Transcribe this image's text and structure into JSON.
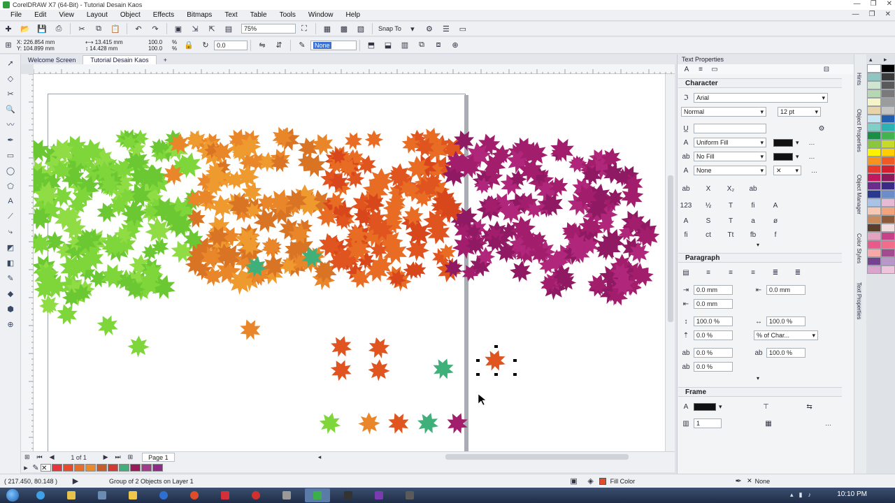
{
  "window": {
    "title": "CorelDRAW X7 (64-Bit) - Tutorial Desain Kaos"
  },
  "menu": [
    "File",
    "Edit",
    "View",
    "Layout",
    "Object",
    "Effects",
    "Bitmaps",
    "Text",
    "Table",
    "Tools",
    "Window",
    "Help"
  ],
  "toolbar1": {
    "zoom": "75%",
    "snap_to": "Snap To"
  },
  "toolbar2": {
    "x": "X: 226.854 mm",
    "y": "Y: 104.899 mm",
    "w": "13.415 mm",
    "h": "14.428 mm",
    "scale_w": "100.0",
    "scale_h": "100.0",
    "pct": "%",
    "rotation": "0.0",
    "outline": "None"
  },
  "tabs": [
    {
      "label": "Welcome Screen"
    },
    {
      "label": "Tutorial Desain Kaos"
    }
  ],
  "page_nav": {
    "pages": "1 of 1",
    "page_tab": "Page 1"
  },
  "status": {
    "coords": "( 217.450, 80.148 )",
    "message": "Group of 2 Objects on Layer 1",
    "fill_label": "Fill Color",
    "outline_label": "None"
  },
  "taskbar": {
    "time": "10:10 PM"
  },
  "docker": {
    "title": "Text Properties",
    "character": {
      "header": "Character",
      "font": "Arial",
      "style": "Normal",
      "size": "12 pt",
      "fill_type": "Uniform Fill",
      "bg_fill": "No Fill",
      "outline": "None"
    },
    "paragraph": {
      "header": "Paragraph",
      "left_indent": "0.0 mm",
      "right_indent": "0.0 mm",
      "first_indent": "0.0 mm",
      "line_spacing": "100.0 %",
      "char_spacing": "100.0 %",
      "before": "0.0 %",
      "spacing_unit": "% of Char...",
      "after": "0.0 %",
      "word_spacing": "100.0 %",
      "lang_spacing": "0.0 %"
    },
    "frame": {
      "header": "Frame",
      "columns": "1"
    }
  },
  "docker_side_tabs": [
    "Hints",
    "Object Properties",
    "Object Manager",
    "Color Styles",
    "Text Properties"
  ],
  "palette_colors": [
    "#ffffff",
    "#000000",
    "#8fc7c0",
    "#3a3a3a",
    "#cfe5cf",
    "#5a5a5a",
    "#b6d7b1",
    "#7a7a7a",
    "#f4f4c8",
    "#9c9c9c",
    "#e9d3a8",
    "#c4c4c4",
    "#c7e6f2",
    "#1f5fae",
    "#7fd1c8",
    "#2bb3b3",
    "#1a8e46",
    "#44b24f",
    "#8cc63f",
    "#c7da2b",
    "#fff200",
    "#ffcd05",
    "#f7941d",
    "#ef5a24",
    "#e63a2e",
    "#d01f2f",
    "#c1185f",
    "#8b1a5c",
    "#6b2d8b",
    "#3b2a86",
    "#2a3b8f",
    "#6c8ec8",
    "#a8c3e6",
    "#e7b9d3",
    "#f6c8b4",
    "#f1a47e",
    "#c98a5c",
    "#8a5a3b",
    "#5a3d2b",
    "#f2dede",
    "#e3a3c1",
    "#c8428a",
    "#e75b8a",
    "#f46c8c",
    "#f7a8a8",
    "#a24c8f",
    "#74428e",
    "#b997c9",
    "#d9a3cc",
    "#f0c3dd"
  ],
  "doc_palette": [
    "#e9333d",
    "#e84a2a",
    "#e96d2a",
    "#ec8a2a",
    "#c85b2a",
    "#d03a33",
    "#3fb07a",
    "#9a1a59",
    "#a43a8b",
    "#8f2a8a"
  ]
}
